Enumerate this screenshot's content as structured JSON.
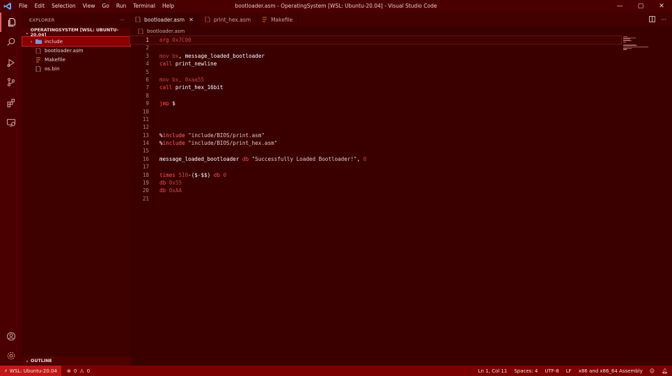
{
  "window": {
    "title": "bootloader.asm - OperatingSystem [WSL: Ubuntu-20.04] - Visual Studio Code",
    "menu": [
      "File",
      "Edit",
      "Selection",
      "View",
      "Go",
      "Run",
      "Terminal",
      "Help"
    ],
    "controls": {
      "minimize": "—",
      "maximize": "▢",
      "close": "✕"
    }
  },
  "activity_bar": [
    "explorer-icon",
    "search-icon",
    "run-debug-icon",
    "source-control-icon",
    "extensions-icon",
    "remote-explorer-icon",
    "account-icon",
    "manage-gear-icon"
  ],
  "sidebar": {
    "header": "EXPLORER",
    "more": "···",
    "section": "OPERATINGSYSTEM [WSL: UBUNTU-20.04]",
    "items": [
      {
        "label": "include",
        "type": "folder"
      },
      {
        "label": "bootloader.asm",
        "type": "asm"
      },
      {
        "label": "Makefile",
        "type": "makefile"
      },
      {
        "label": "os.bin",
        "type": "bin"
      }
    ],
    "outline": "OUTLINE"
  },
  "tabs": [
    {
      "label": "bootloader.asm",
      "active": true,
      "close": "✕"
    },
    {
      "label": "print_hex.asm",
      "active": false
    },
    {
      "label": "Makefile",
      "active": false
    }
  ],
  "breadcrumb": "bootloader.asm",
  "code": {
    "line_numbers": [
      "1",
      "2",
      "3",
      "4",
      "5",
      "6",
      "7",
      "8",
      "9",
      "10",
      "11",
      "12",
      "13",
      "14",
      "15",
      "16",
      "17",
      "18",
      "19",
      "20",
      "21"
    ]
  },
  "statusbar": {
    "remote": "WSL: Ubuntu-20.04",
    "problems": "0",
    "warnings": "0",
    "cursor": "Ln 1, Col 11",
    "spaces": "Spaces: 4",
    "encoding": "UTF-8",
    "eol": "LF",
    "language": "x86 and x86_64 Assembly"
  },
  "colors": {
    "background": "#3a0000",
    "statusbar": "#7a0000",
    "remote": "#c01818",
    "keyword": "#ff4c4c"
  }
}
